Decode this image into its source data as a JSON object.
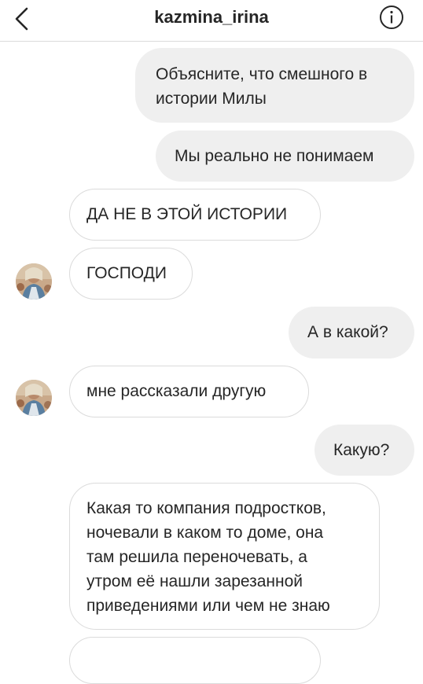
{
  "header": {
    "title": "kazmina_irina",
    "back_icon": "chevron-left-icon",
    "info_icon": "info-icon"
  },
  "messages": [
    {
      "from": "me",
      "lines": [
        "Объясните, что смешного в",
        "истории Милы"
      ]
    },
    {
      "from": "me",
      "lines": [
        "Мы реально не понимаем"
      ]
    },
    {
      "from": "them",
      "lines": [
        "ДА НЕ В ЭТОЙ ИСТОРИИ"
      ]
    },
    {
      "from": "them",
      "lines": [
        "ГОСПОДИ"
      ]
    },
    {
      "from": "me",
      "lines": [
        "А в какой?"
      ]
    },
    {
      "from": "them",
      "lines": [
        "мне рассказали другую"
      ]
    },
    {
      "from": "me",
      "lines": [
        "Какую?"
      ]
    },
    {
      "from": "them",
      "lines": [
        "Какая то компания подростков,",
        "ночевали в каком то доме, она",
        "там решила переночевать, а",
        "утром её нашли зарезанной",
        "приведениями или чем не знаю"
      ]
    }
  ],
  "colors": {
    "outgoing_bubble": "#efefef",
    "incoming_border": "#dbdbdb",
    "text": "#262626"
  }
}
